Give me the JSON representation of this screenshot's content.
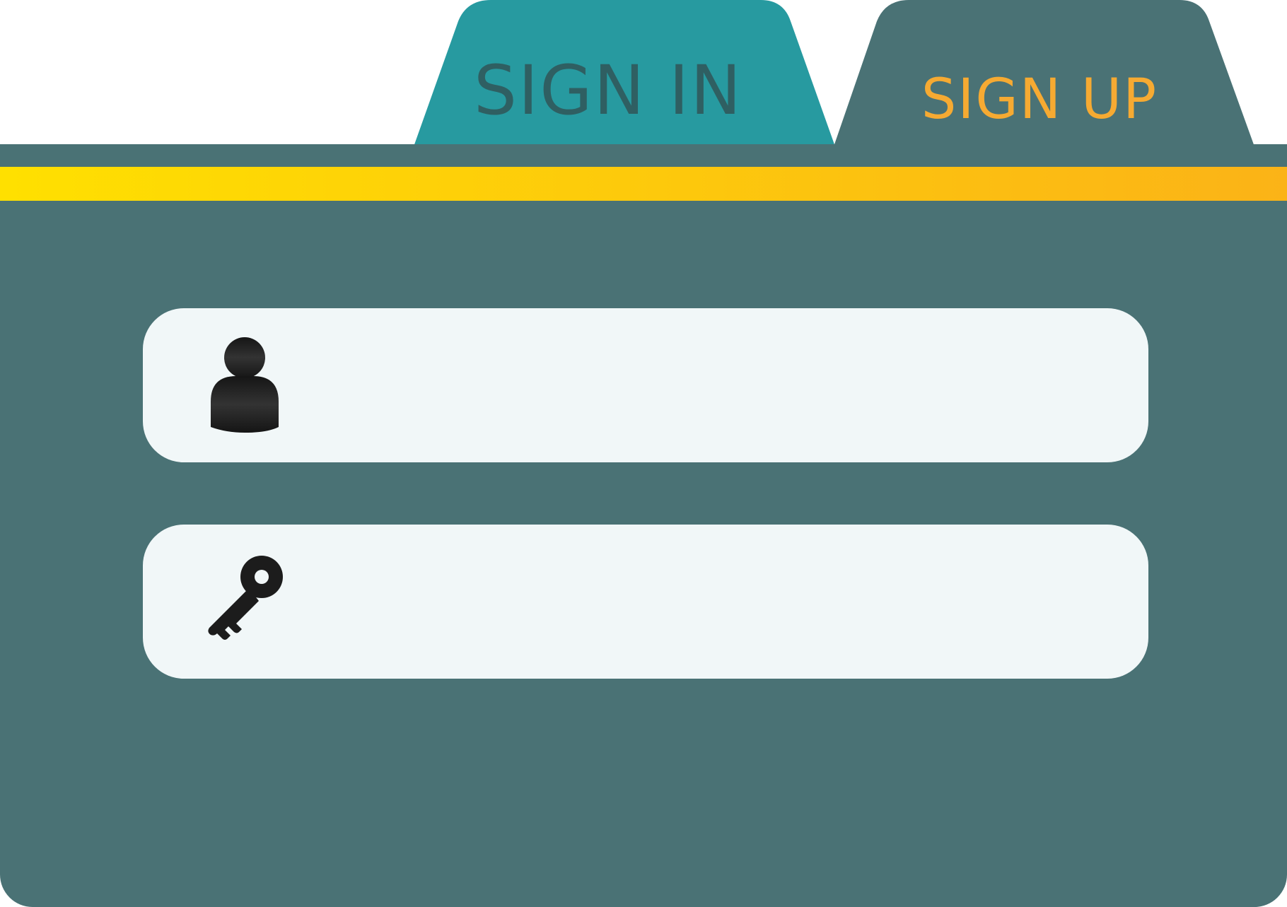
{
  "tabs": {
    "sign_in": {
      "label": "SIGN IN",
      "active": true
    },
    "sign_up": {
      "label": "SIGN UP",
      "active": false
    }
  },
  "form": {
    "username": {
      "icon": "user-icon",
      "value": "",
      "placeholder": ""
    },
    "password": {
      "icon": "key-icon",
      "value": "",
      "placeholder": ""
    }
  },
  "colors": {
    "panel": "#4a7275",
    "active_tab": "#279aa0",
    "active_tab_text": "#2f5f62",
    "inactive_tab_text": "#f6aa32",
    "field_background": "#f1f7f8",
    "icon": "#1c1c1c",
    "stripe_start": "#ffe000",
    "stripe_end": "#fbb317"
  }
}
